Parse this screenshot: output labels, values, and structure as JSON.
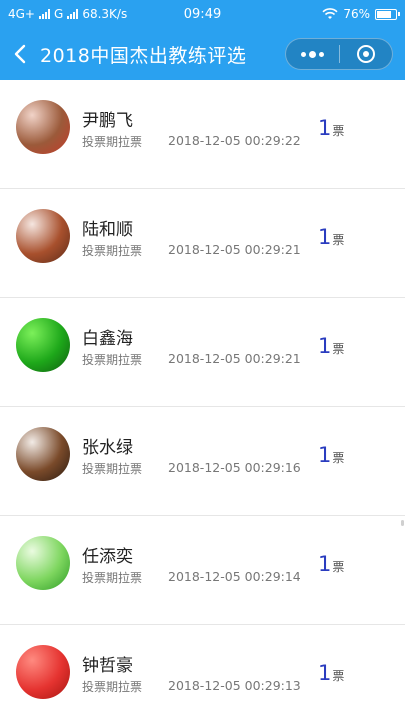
{
  "status": {
    "network": "4G+",
    "carrier": "G",
    "speed": "68.3K/s",
    "time": "09:49",
    "battery": "76%"
  },
  "navbar": {
    "title": "2018中国杰出教练评选"
  },
  "items": [
    {
      "name": "尹鹏飞",
      "tag": "投票期拉票",
      "time": "2018-12-05 00:29:22",
      "votes": "1",
      "unit": "票",
      "avatar_colors": [
        "#f1d3c8",
        "#9b5a3a",
        "#c43b2a"
      ]
    },
    {
      "name": "陆和顺",
      "tag": "投票期拉票",
      "time": "2018-12-05 00:29:21",
      "votes": "1",
      "unit": "票",
      "avatar_colors": [
        "#f5e6e0",
        "#a8502d",
        "#5c2b18"
      ]
    },
    {
      "name": "白鑫海",
      "tag": "投票期拉票",
      "time": "2018-12-05 00:29:21",
      "votes": "1",
      "unit": "票",
      "avatar_colors": [
        "#7cf05a",
        "#1ea81a",
        "#0f5c10"
      ]
    },
    {
      "name": "张水绿",
      "tag": "投票期拉票",
      "time": "2018-12-05 00:29:16",
      "votes": "1",
      "unit": "票",
      "avatar_colors": [
        "#f2ebe6",
        "#7a4a2a",
        "#2a1a10"
      ]
    },
    {
      "name": "任添奕",
      "tag": "投票期拉票",
      "time": "2018-12-05 00:29:14",
      "votes": "1",
      "unit": "票",
      "avatar_colors": [
        "#eafbe0",
        "#7ed65f",
        "#2b9a24"
      ]
    },
    {
      "name": "钟哲豪",
      "tag": "投票期拉票",
      "time": "2018-12-05 00:29:13",
      "votes": "1",
      "unit": "票",
      "avatar_colors": [
        "#ff8a80",
        "#e53330",
        "#a51510"
      ]
    }
  ]
}
